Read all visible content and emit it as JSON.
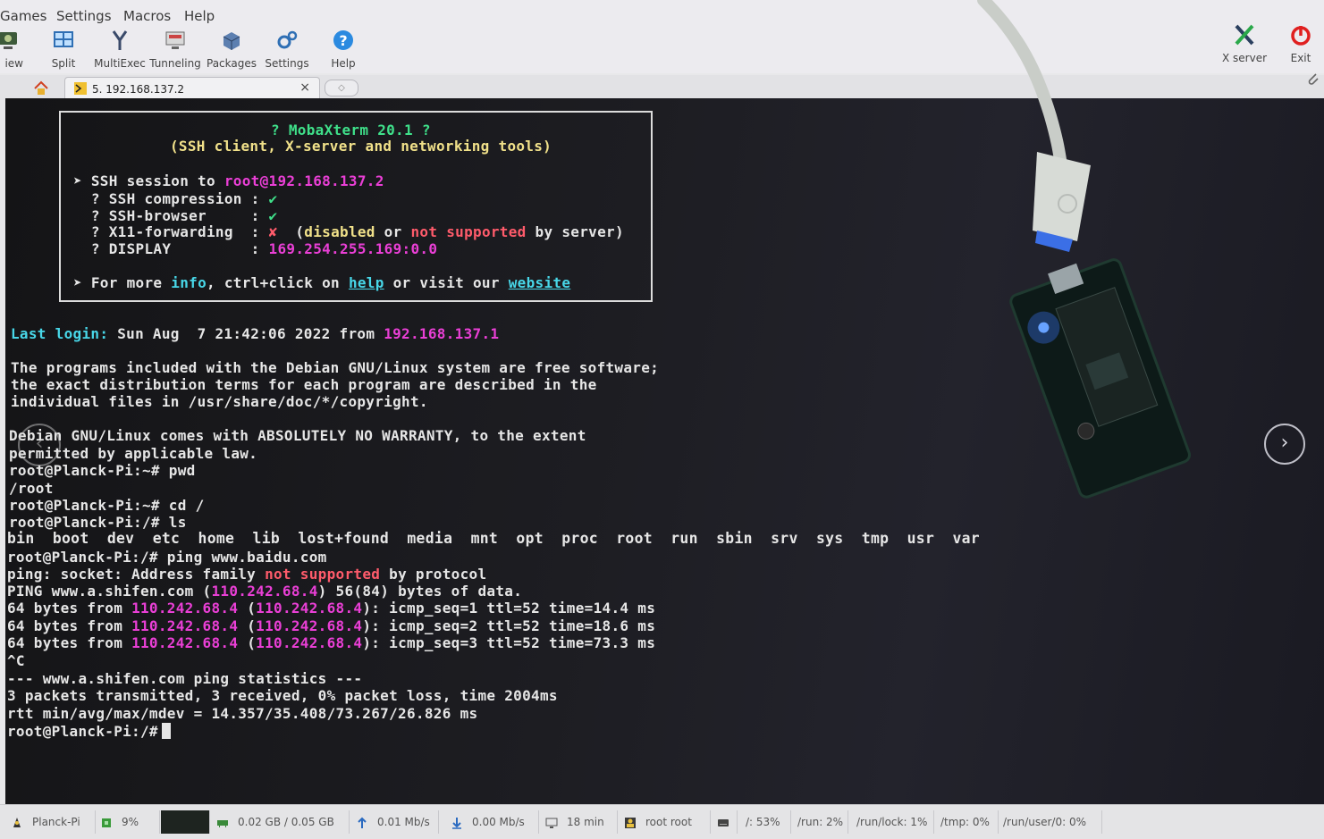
{
  "menu": [
    "Games",
    "Settings",
    "Macros",
    "Help"
  ],
  "toolbar": {
    "view": "iew",
    "split": "Split",
    "multiexec": "MultiExec",
    "tunneling": "Tunneling",
    "packages": "Packages",
    "settings": "Settings",
    "help": "Help",
    "xserver": "X server",
    "exit": "Exit"
  },
  "tab": {
    "label": "5. 192.168.137.2",
    "close": "×"
  },
  "banner": {
    "title": "? MobaXterm 20.1 ?",
    "subtitle": "(SSH client, X-server and networking tools)",
    "session_prefix": "➤ SSH session to ",
    "session_user": "root@",
    "session_host": "192.168.137.2",
    "compression_label": "  ? SSH compression : ",
    "browser_label": "  ? SSH-browser     : ",
    "check": "✔",
    "x11_label": "  ? X11-forwarding  : ",
    "cross": "✘",
    "x11_open": "  (",
    "x11_disabled": "disabled",
    "x11_or": " or ",
    "x11_notsupported": "not supported",
    "x11_close": " by server)",
    "display_label": "  ? DISPLAY         : ",
    "display_value": "169.254.255.169:0.0",
    "more_prefix": "➤ For more ",
    "more_info": "info",
    "more_mid": ", ctrl+click on ",
    "more_help": "help",
    "more_visit": " or visit our ",
    "more_website": "website"
  },
  "terminal": {
    "lastlogin_label": "Last login:",
    "lastlogin_text": " Sun Aug  7 21:42:06 2022 from ",
    "lastlogin_ip": "192.168.137.1",
    "motd1": "The programs included with the Debian GNU/Linux system are free software;",
    "motd2": "the exact distribution terms for each program are described in the",
    "motd3": "individual files in /usr/share/doc/*/copyright.",
    "warranty1": "Debian GNU/Linux comes with ABSOLUTELY NO WARRANTY, to the extent",
    "warranty2": "permitted by applicable law.",
    "cmd_pwd": "root@Planck-Pi:~# pwd",
    "out_pwd": "/root",
    "cmd_cd": "root@Planck-Pi:~# cd /",
    "cmd_ls": "root@Planck-Pi:/# ls",
    "out_ls": "bin  boot  dev  etc  home  lib  lost+found  media  mnt  opt  proc  root  run  sbin  srv  sys  tmp  usr  var",
    "cmd_ping": "root@Planck-Pi:/# ping www.baidu.com",
    "err_prefix": "ping: socket: Address family ",
    "err_highlight": "not supported",
    "err_suffix": " by protocol",
    "ping_prefix": "PING www.a.shifen.com (",
    "ping_ip": "110.242.68.4",
    "ping_suffix": ") 56(84) bytes of data.",
    "reply_prefix": "64 bytes from ",
    "reply_ip": "110.242.68.4",
    "reply_open": " (",
    "reply_close": "): ",
    "reply1_tail": "icmp_seq=1 ttl=52 time=14.4 ms",
    "reply2_tail": "icmp_seq=2 ttl=52 time=18.6 ms",
    "reply3_tail": "icmp_seq=3 ttl=52 time=73.3 ms",
    "ctrlc": "^C",
    "stats_header": "--- www.a.shifen.com ping statistics ---",
    "stats_packets": "3 packets transmitted, 3 received, 0% packet loss, time 2004ms",
    "stats_rtt": "rtt min/avg/max/mdev = 14.357/35.408/73.267/26.826 ms",
    "prompt": "root@Planck-Pi:/# "
  },
  "statusbar": {
    "host": "Planck-Pi",
    "cpu": "9%",
    "mem": "0.02 GB / 0.05 GB",
    "upload": "0.01 Mb/s",
    "download": "0.00 Mb/s",
    "uptime": "18 min",
    "users": "root  root",
    "disk_root": "/: 53%",
    "disk_run": "/run: 2%",
    "disk_runlock": "/run/lock: 1%",
    "disk_tmp": "/tmp: 0%",
    "disk_runuser": "/run/user/0: 0%"
  },
  "colors": {
    "prompt_text": "#e6e6e6",
    "ip_magenta": "#ea3fd6",
    "cyan_link": "#48d7e8",
    "error_red": "#ff5b6b",
    "terminal_bg": "#1d1d22"
  },
  "icons": [
    "view-icon",
    "split-icon",
    "multiexec-icon",
    "tunneling-icon",
    "packages-icon",
    "settings-icon",
    "help-icon",
    "xserver-icon",
    "exit-icon",
    "home-icon",
    "terminal-tab-icon",
    "attach-icon"
  ]
}
